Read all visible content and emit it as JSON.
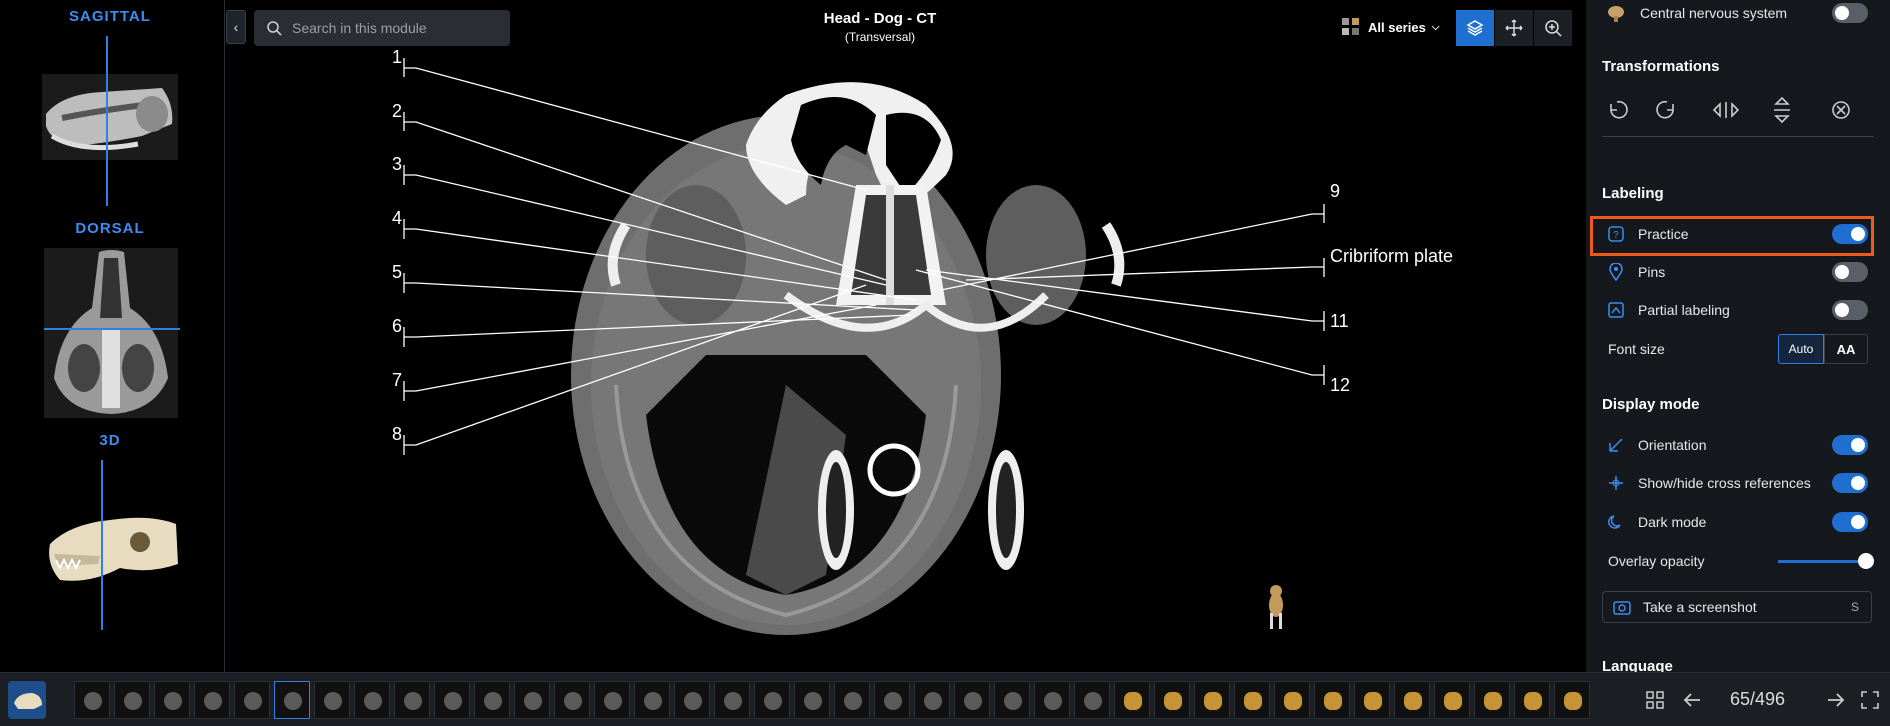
{
  "left_panel": {
    "views": [
      {
        "title": "SAGITTAL"
      },
      {
        "title": "DORSAL"
      },
      {
        "title": "3D"
      }
    ]
  },
  "header": {
    "search_placeholder": "Search in this module",
    "title": "Head - Dog - CT",
    "subtitle": "(Transversal)",
    "series_label": "All series"
  },
  "labels": {
    "left": [
      "1",
      "2",
      "3",
      "4",
      "5",
      "6",
      "7",
      "8"
    ],
    "right": [
      "9",
      "Cribriform plate",
      "11",
      "12"
    ]
  },
  "right_panel": {
    "cns_label": "Central nervous system",
    "transformations_title": "Transformations",
    "labeling_title": "Labeling",
    "practice_label": "Practice",
    "pins_label": "Pins",
    "partial_label": "Partial labeling",
    "font_size_label": "Font size",
    "font_auto": "Auto",
    "font_aa": "AA",
    "display_title": "Display mode",
    "orientation_label": "Orientation",
    "cross_label": "Show/hide cross references",
    "dark_label": "Dark mode",
    "opacity_label": "Overlay opacity",
    "screenshot_label": "Take a screenshot",
    "screenshot_shortcut": "S",
    "language_title": "Language",
    "toggles": {
      "cns": false,
      "practice": true,
      "pins": false,
      "partial": false,
      "orientation": true,
      "cross": true,
      "dark": true
    },
    "overlay_opacity": 1.0
  },
  "bottom": {
    "counter": "65/496"
  },
  "colors": {
    "accent": "#1f6fd1",
    "highlight": "#ef5a1c",
    "view_title": "#3b8ef0"
  }
}
